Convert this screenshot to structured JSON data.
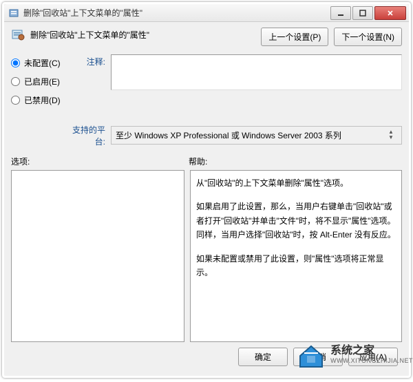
{
  "titlebar": {
    "title": "删除\"回收站\"上下文菜单的\"属性\""
  },
  "header": {
    "title": "删除\"回收站\"上下文菜单的\"属性\""
  },
  "nav": {
    "prev": "上一个设置(P)",
    "next": "下一个设置(N)"
  },
  "radios": {
    "not_configured": "未配置(C)",
    "enabled": "已启用(E)",
    "disabled": "已禁用(D)"
  },
  "fields": {
    "comment_label": "注释:",
    "platform_label": "支持的平台:",
    "platform_value": "至少 Windows XP Professional 或 Windows Server 2003 系列"
  },
  "sections": {
    "options": "选项:",
    "help": "帮助:"
  },
  "help": {
    "p1": "从\"回收站\"的上下文菜单删除\"属性\"选项。",
    "p2": "如果启用了此设置，那么，当用户右键单击\"回收站\"或者打开\"回收站\"并单击\"文件\"时，将不显示\"属性\"选项。同样，当用户选择\"回收站\"时，按 Alt-Enter 没有反应。",
    "p3": "如果未配置或禁用了此设置，则\"属性\"选项将正常显示。"
  },
  "buttons": {
    "ok": "确定",
    "cancel": "取消",
    "apply": "应用(A)"
  },
  "watermark": {
    "main": "系统之家",
    "sub": "WWW.XITONGZHIJIA.NET"
  }
}
